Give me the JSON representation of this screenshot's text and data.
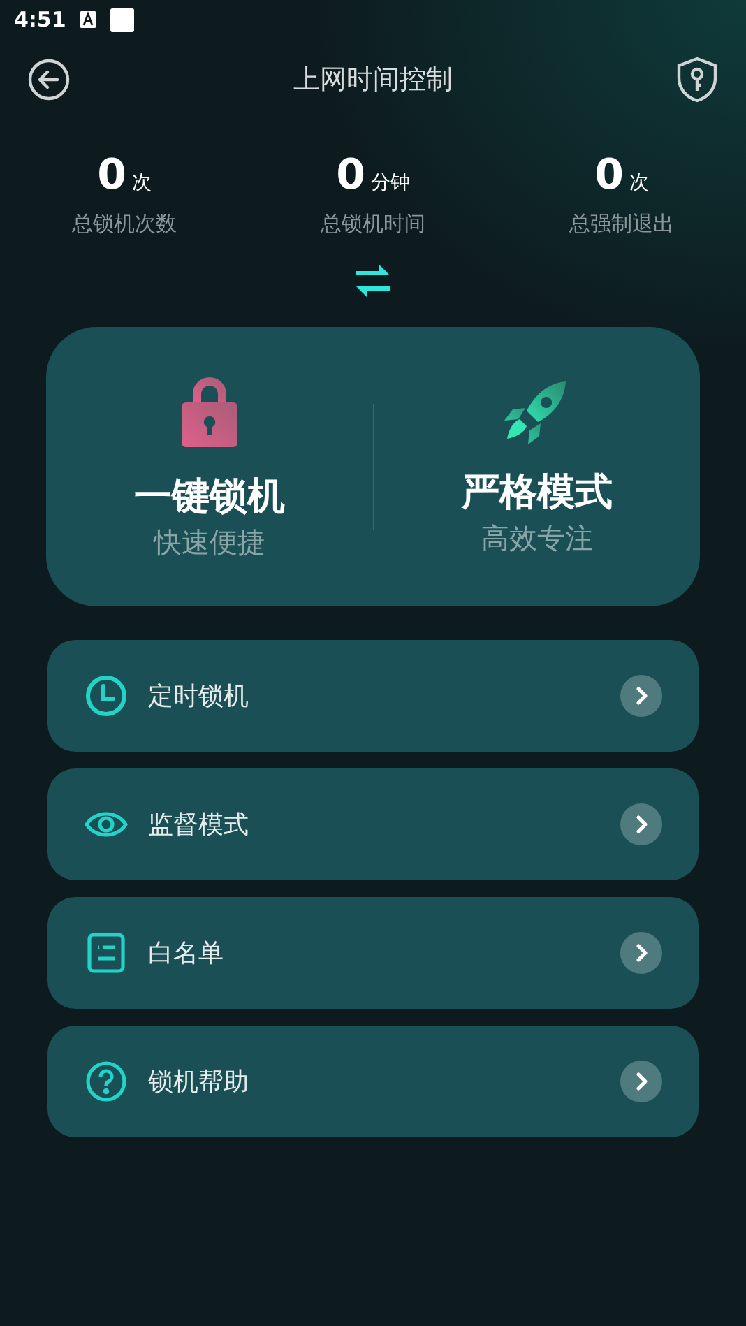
{
  "status_bar": {
    "time": "4:51"
  },
  "header": {
    "title": "上网时间控制"
  },
  "stats": [
    {
      "value": "0",
      "unit": "次",
      "label": "总锁机次数"
    },
    {
      "value": "0",
      "unit": "分钟",
      "label": "总锁机时间"
    },
    {
      "value": "0",
      "unit": "次",
      "label": "总强制退出"
    }
  ],
  "modes": [
    {
      "kind": "lock",
      "title": "一键锁机",
      "subtitle": "快速便捷"
    },
    {
      "kind": "rocket",
      "title": "严格模式",
      "subtitle": "高效专注"
    }
  ],
  "menu": [
    {
      "kind": "clock",
      "label": "定时锁机"
    },
    {
      "kind": "eye",
      "label": "监督模式"
    },
    {
      "kind": "list",
      "label": "白名单"
    },
    {
      "kind": "help",
      "label": "锁机帮助"
    }
  ]
}
